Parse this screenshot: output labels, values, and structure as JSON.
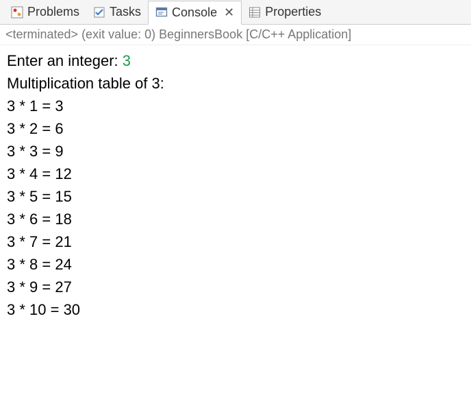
{
  "tabs": {
    "problems": "Problems",
    "tasks": "Tasks",
    "console": "Console",
    "properties": "Properties"
  },
  "status": "<terminated> (exit value: 0) BeginnersBook [C/C++ Application]",
  "console": {
    "prompt": "Enter an integer: ",
    "input_value": "3",
    "header": "Multiplication table of 3:",
    "lines": [
      "3 * 1 = 3",
      "3 * 2 = 6",
      "3 * 3 = 9",
      "3 * 4 = 12",
      "3 * 5 = 15",
      "3 * 6 = 18",
      "3 * 7 = 21",
      "3 * 8 = 24",
      "3 * 9 = 27",
      "3 * 10 = 30"
    ]
  }
}
